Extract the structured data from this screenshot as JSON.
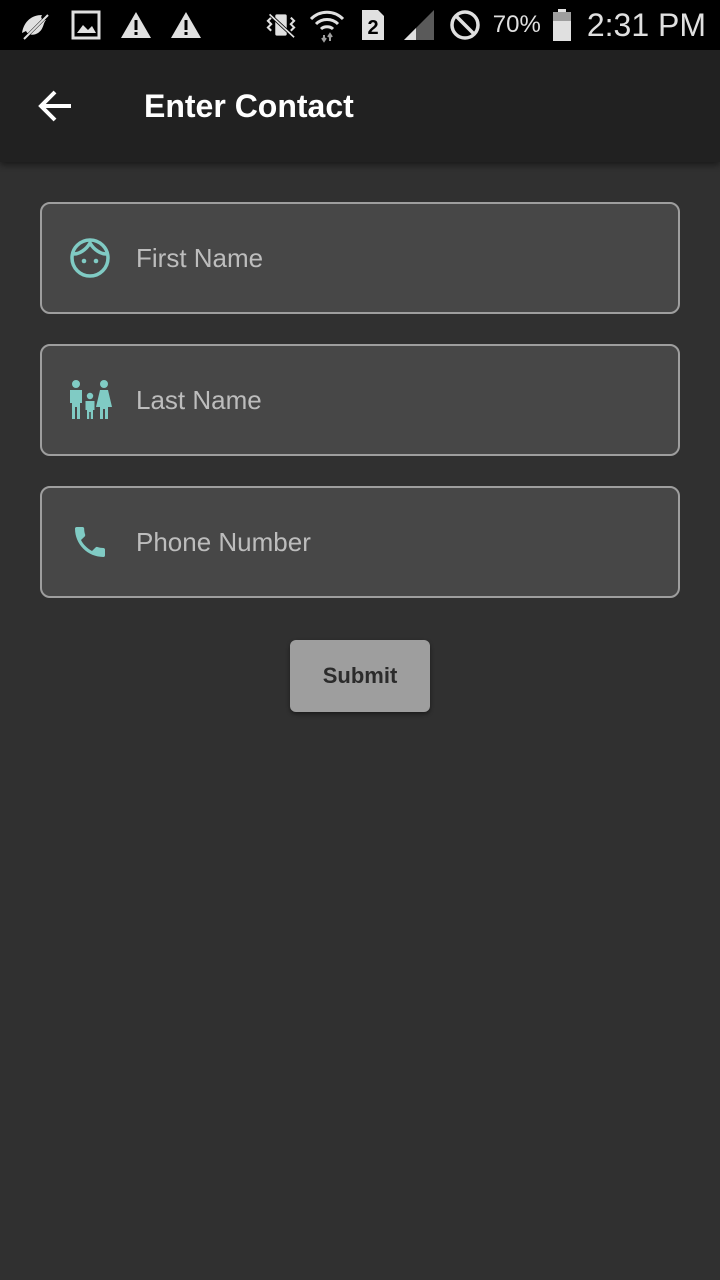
{
  "status_bar": {
    "battery_percent": "70%",
    "time": "2:31 PM",
    "sim_slot": "2",
    "icons": [
      "bird-icon",
      "gallery-icon",
      "warning-icon",
      "warning-icon",
      "vibrate-mute-icon",
      "wifi-icon",
      "sim-2-icon",
      "signal-icon",
      "blocked-icon",
      "battery-icon"
    ]
  },
  "app_bar": {
    "title": "Enter Contact",
    "back_icon": "arrow-back-icon"
  },
  "form": {
    "first_name": {
      "placeholder": "First Name",
      "value": "",
      "icon": "face-icon"
    },
    "last_name": {
      "placeholder": "Last Name",
      "value": "",
      "icon": "family-icon"
    },
    "phone": {
      "placeholder": "Phone Number",
      "value": "",
      "icon": "phone-icon"
    },
    "submit_label": "Submit"
  },
  "colors": {
    "accent": "#80cbc4",
    "background": "#303030",
    "app_bar": "#212121",
    "field_background": "#474747",
    "field_border": "#9e9e9e",
    "button": "#9e9e9e"
  }
}
